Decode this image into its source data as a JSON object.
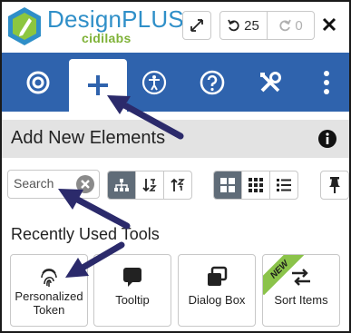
{
  "header": {
    "brand_main": "DesignPLUS",
    "brand_sub": "cidilabs",
    "undo_count": "25",
    "redo_count": "0"
  },
  "nav": {
    "items": [
      {
        "icon": "target-icon"
      },
      {
        "icon": "plus-icon",
        "active": true
      },
      {
        "icon": "accessibility-icon"
      },
      {
        "icon": "help-icon"
      },
      {
        "icon": "tools-icon"
      },
      {
        "icon": "more-vertical-icon"
      }
    ]
  },
  "section": {
    "title": "Add New Elements"
  },
  "toolbar": {
    "search_placeholder": "Search",
    "view_buttons": [
      "hierarchy-icon",
      "sort-desc-icon",
      "sort-asc-icon"
    ],
    "layout_buttons": [
      "grid-large-icon",
      "grid-small-icon",
      "list-icon"
    ],
    "active_layout": "grid-large-icon"
  },
  "recent": {
    "title": "Recently Used Tools",
    "tiles": [
      {
        "label": "Personalized Token",
        "icon": "fingerprint-icon"
      },
      {
        "label": "Tooltip",
        "icon": "speech-bubble-icon"
      },
      {
        "label": "Dialog Box",
        "icon": "windows-icon"
      },
      {
        "label": "Sort Items",
        "icon": "swap-arrows-icon",
        "badge": "NEW"
      }
    ]
  },
  "colors": {
    "nav_blue": "#2f63ad",
    "brand_blue": "#2f8fc8",
    "brand_green": "#7fb238",
    "arrow": "#2b2a6b",
    "new_badge": "#8bc34a"
  }
}
